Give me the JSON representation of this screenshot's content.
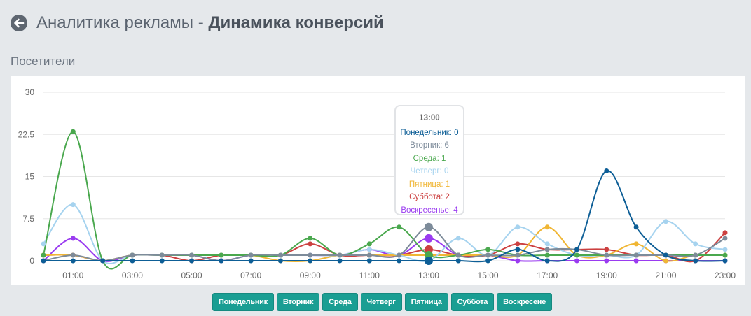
{
  "header": {
    "title_prefix": "Аналитика рекламы",
    "title_separator": " - ",
    "title_bold": "Динамика конверсий"
  },
  "section_label": "Посетители",
  "tooltip": {
    "title": "13:00",
    "lines": [
      {
        "text": "Понедельник: 0",
        "color": "#0d5e96"
      },
      {
        "text": "Вторник: 6",
        "color": "#7d8b9a"
      },
      {
        "text": "Среда: 1",
        "color": "#4aa84e"
      },
      {
        "text": "Четверг: 0",
        "color": "#a6d3ef"
      },
      {
        "text": "Пятница: 1",
        "color": "#f0b634"
      },
      {
        "text": "Суббота: 2",
        "color": "#cc4040"
      },
      {
        "text": "Воскресенье: 4",
        "color": "#9a3bf0"
      }
    ]
  },
  "legend": [
    {
      "label": "Понедельник"
    },
    {
      "label": "Вторник"
    },
    {
      "label": "Среда"
    },
    {
      "label": "Четверг"
    },
    {
      "label": "Пятница"
    },
    {
      "label": "Суббота"
    },
    {
      "label": "Воскресене"
    }
  ],
  "chart_data": {
    "type": "line",
    "x": [
      0,
      1,
      2,
      3,
      4,
      5,
      6,
      7,
      8,
      9,
      10,
      11,
      12,
      13,
      14,
      15,
      16,
      17,
      18,
      19,
      20,
      21,
      22,
      23
    ],
    "x_tick_labels": [
      "01:00",
      "03:00",
      "05:00",
      "07:00",
      "09:00",
      "11:00",
      "13:00",
      "15:00",
      "17:00",
      "19:00",
      "21:00",
      "23:00"
    ],
    "x_tick_positions": [
      1,
      3,
      5,
      7,
      9,
      11,
      13,
      15,
      17,
      19,
      21,
      23
    ],
    "ylim": [
      0,
      30
    ],
    "y_ticks": [
      "0",
      "7.5",
      "15",
      "22.5",
      "30"
    ],
    "y_tick_values": [
      0,
      7.5,
      15,
      22.5,
      30
    ],
    "grid": true,
    "highlight_x": 13,
    "series": [
      {
        "name": "Понедельник",
        "color": "#0d5e96",
        "values": [
          0,
          0,
          0,
          0,
          0,
          0,
          0,
          0,
          0,
          0,
          0,
          0,
          0,
          0,
          0,
          0,
          2,
          0,
          2,
          16,
          6,
          1,
          0,
          0
        ]
      },
      {
        "name": "Вторник",
        "color": "#7d8b9a",
        "values": [
          0,
          1,
          0,
          1,
          1,
          1,
          0,
          1,
          1,
          1,
          1,
          1,
          1,
          6,
          1,
          1,
          1,
          2,
          2,
          1,
          1,
          1,
          1,
          4
        ]
      },
      {
        "name": "Среда",
        "color": "#4aa84e",
        "values": [
          1,
          23,
          0,
          1,
          1,
          1,
          1,
          1,
          1,
          4,
          1,
          3,
          6,
          1,
          1,
          2,
          1,
          1,
          1,
          1,
          1,
          1,
          1,
          1
        ]
      },
      {
        "name": "Четверг",
        "color": "#a6d3ef",
        "values": [
          3,
          10,
          0,
          1,
          1,
          1,
          1,
          1,
          1,
          1,
          1,
          2,
          1,
          0,
          4,
          1,
          6,
          3,
          1,
          1,
          1,
          7,
          3,
          2
        ]
      },
      {
        "name": "Пятница",
        "color": "#f0b634",
        "values": [
          1,
          1,
          0,
          1,
          1,
          1,
          1,
          1,
          0,
          0,
          1,
          1,
          1,
          1,
          1,
          1,
          1,
          6,
          1,
          1,
          3,
          0,
          1,
          1
        ]
      },
      {
        "name": "Суббота",
        "color": "#cc4040",
        "values": [
          1,
          1,
          0,
          1,
          1,
          0,
          1,
          1,
          1,
          3,
          1,
          1,
          1,
          2,
          1,
          1,
          3,
          2,
          2,
          2,
          1,
          1,
          0,
          5
        ]
      },
      {
        "name": "Воскресенье",
        "color": "#9a3bf0",
        "values": [
          0,
          4,
          0,
          1,
          1,
          1,
          0,
          1,
          1,
          1,
          1,
          2,
          1,
          4,
          1,
          1,
          0,
          0,
          0,
          0,
          0,
          0,
          0,
          0
        ]
      }
    ]
  }
}
